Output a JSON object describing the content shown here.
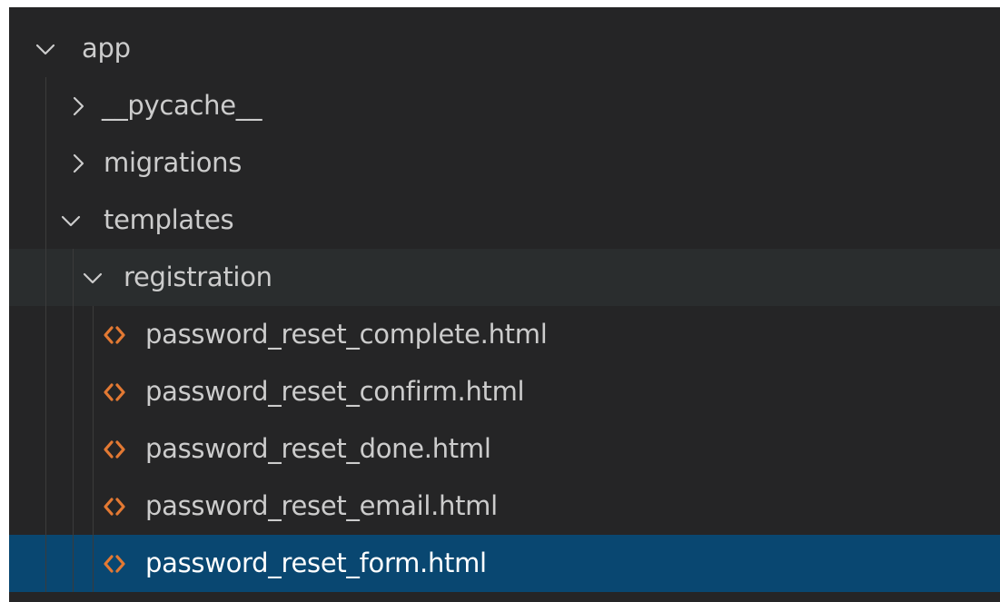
{
  "explorer": {
    "root": {
      "label": "app",
      "expanded": true,
      "icon": "chevron-down-icon"
    },
    "items": [
      {
        "label": "__pycache__",
        "kind": "folder",
        "expanded": false,
        "icon": "chevron-right-icon"
      },
      {
        "label": "migrations",
        "kind": "folder",
        "expanded": false,
        "icon": "chevron-right-icon"
      },
      {
        "label": "templates",
        "kind": "folder",
        "expanded": true,
        "icon": "chevron-down-icon"
      },
      {
        "label": "registration",
        "kind": "folder",
        "expanded": true,
        "icon": "chevron-down-icon"
      },
      {
        "label": "password_reset_complete.html",
        "kind": "file",
        "icon": "html-file-icon"
      },
      {
        "label": "password_reset_confirm.html",
        "kind": "file",
        "icon": "html-file-icon"
      },
      {
        "label": "password_reset_done.html",
        "kind": "file",
        "icon": "html-file-icon"
      },
      {
        "label": "password_reset_email.html",
        "kind": "file",
        "icon": "html-file-icon"
      },
      {
        "label": "password_reset_form.html",
        "kind": "file",
        "selected": true,
        "icon": "html-file-icon"
      }
    ]
  },
  "colors": {
    "background": "#252526",
    "text": "#cccccc",
    "selected_background": "#094771",
    "hover_background": "#2a2d2e",
    "html_icon": "#e37933",
    "indent_guide": "#3b3b3b"
  }
}
